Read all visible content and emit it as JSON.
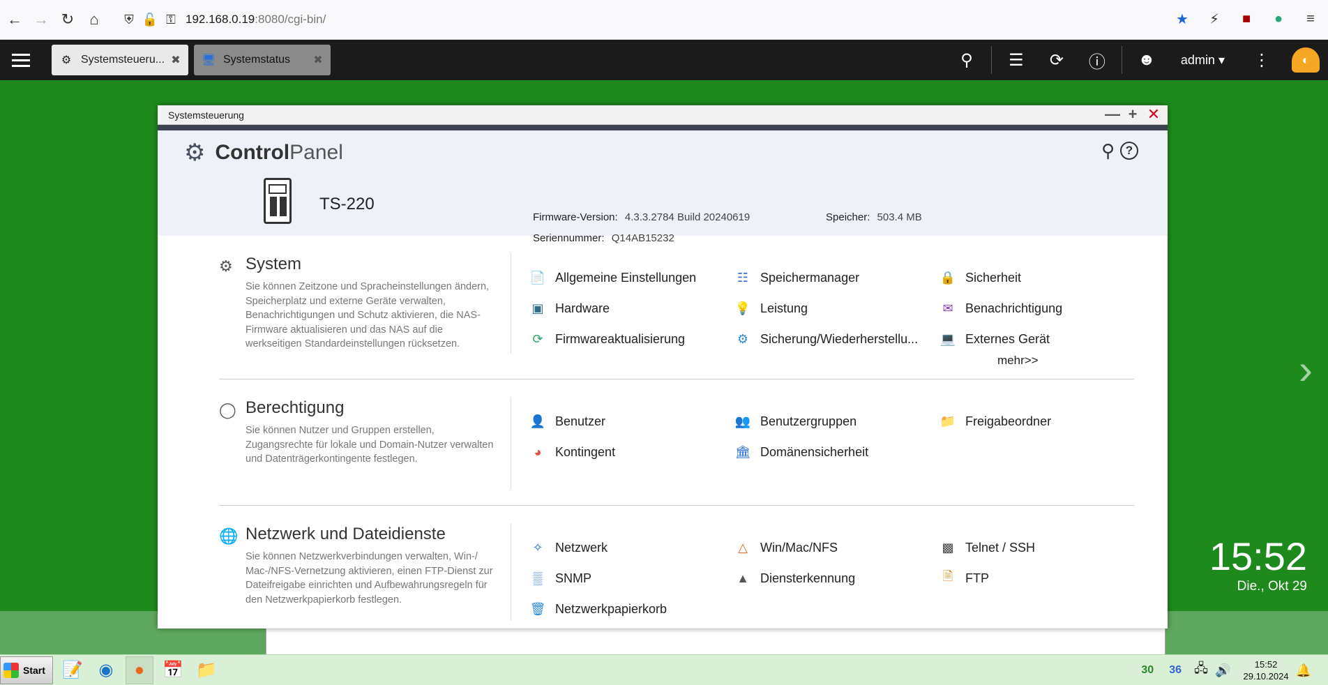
{
  "browser": {
    "url_host": "192.168.0.19",
    "url_rest": ":8080/cgi-bin/"
  },
  "qnap_bar": {
    "tabs": [
      {
        "label": "Systemsteueru...",
        "icon": "gear-icon"
      },
      {
        "label": "Systemstatus",
        "icon": "monitor-icon"
      }
    ],
    "user": "admin"
  },
  "window": {
    "title": "Systemsteuerung",
    "header_bold": "Control",
    "header_light": "Panel",
    "model": "TS-220",
    "firmware_label": "Firmware-Version:",
    "firmware_value": "4.3.3.2784 Build 20240619",
    "serial_label": "Seriennummer:",
    "serial_value": "Q14AB15232",
    "memory_label": "Speicher:",
    "memory_value": "503.4 MB"
  },
  "sections": {
    "system": {
      "title": "System",
      "description": "Sie können Zeitzone und Spracheinstellungen ändern, Speicherplatz und externe Geräte verwalten, Benachrichtigungen und Schutz aktivieren, die NAS-Firmware aktualisieren und das NAS auf die werkseitigen Standardeinstellungen rücksetzen.",
      "items": [
        "Allgemeine Einstellungen",
        "Speichermanager",
        "Sicherheit",
        "Hardware",
        "Leistung",
        "Benachrichtigung",
        "Firmwareaktualisierung",
        "Sicherung/Wiederherstellu...",
        "Externes Gerät"
      ],
      "more": "mehr>>"
    },
    "permission": {
      "title": "Berechtigung",
      "description": "Sie können Nutzer und Gruppen erstellen, Zugangsrechte für lokale und Domain-Nutzer verwalten und Datenträgerkontingente festlegen.",
      "items": [
        "Benutzer",
        "Benutzergruppen",
        "Freigabeordner",
        "Kontingent",
        "Domänensicherheit"
      ]
    },
    "network": {
      "title": "Netzwerk und Dateidienste",
      "description": "Sie können Netzwerkverbindungen verwalten, Win-/ Mac-/NFS-Vernetzung aktivieren, einen FTP-Dienst zur Dateifreigabe einrichten und Aufbewahrungsregeln für den Netzwerkpapierkorb festlegen.",
      "items": [
        "Netzwerk",
        "Win/Mac/NFS",
        "Telnet / SSH",
        "SNMP",
        "Diensterkennung",
        "FTP",
        "Netzwerkpapierkorb"
      ]
    }
  },
  "desktop": {
    "clock": "15:52",
    "date": "Die., Okt 29"
  },
  "taskbar": {
    "start": "Start",
    "tray_num1": "30",
    "tray_num2": "36",
    "time": "15:52",
    "date": "29.10.2024"
  }
}
